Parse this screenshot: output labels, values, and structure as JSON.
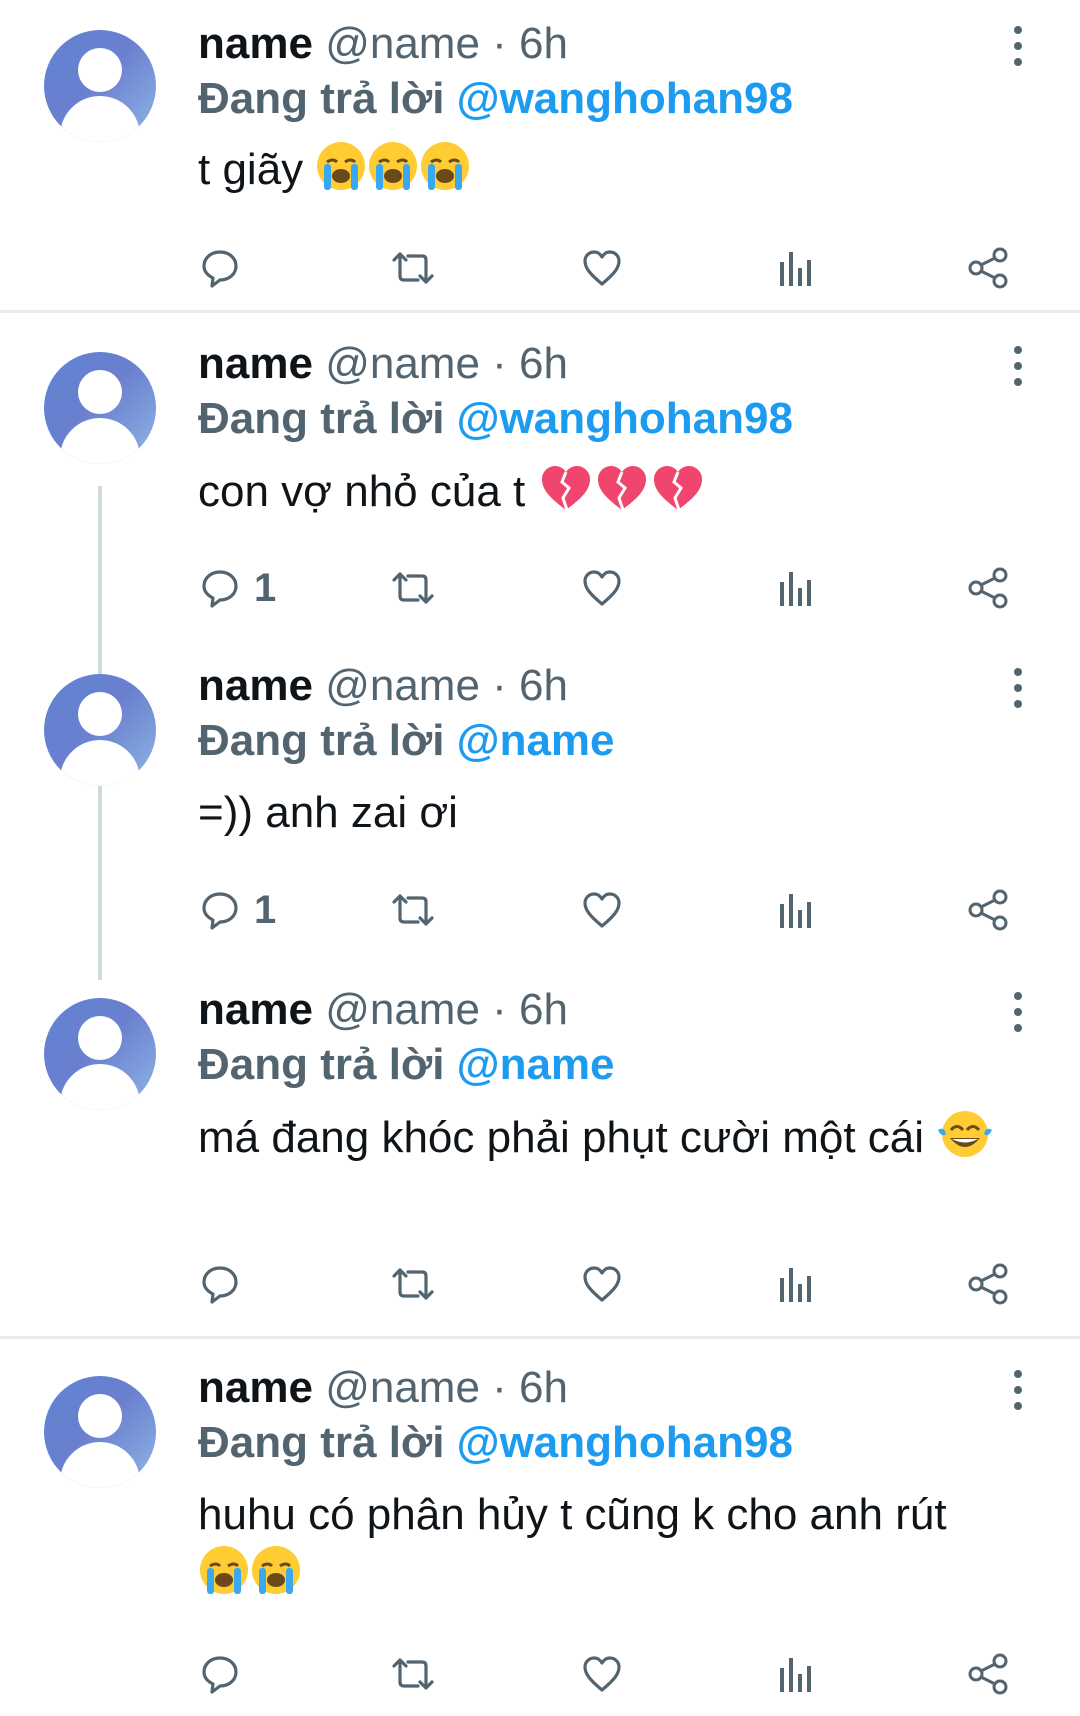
{
  "tweets": [
    {
      "display_name": "name",
      "handle": "@name",
      "separator": "·",
      "time": "6h",
      "reply_prefix": "Đang trả lời",
      "reply_target": "@wanghohan98",
      "text": "t giãy",
      "emojis": [
        "loudly-crying-face",
        "loudly-crying-face",
        "loudly-crying-face"
      ],
      "reply_count": ""
    },
    {
      "display_name": "name",
      "handle": "@name",
      "separator": "·",
      "time": "6h",
      "reply_prefix": "Đang trả lời",
      "reply_target": "@wanghohan98",
      "text": "con vợ nhỏ của t",
      "emojis": [
        "broken-heart",
        "broken-heart",
        "broken-heart"
      ],
      "reply_count": "1"
    },
    {
      "display_name": "name",
      "handle": "@name",
      "separator": "·",
      "time": "6h",
      "reply_prefix": "Đang trả lời",
      "reply_target": "@name",
      "text": "=)) anh zai ơi",
      "emojis": [],
      "reply_count": "1"
    },
    {
      "display_name": "name",
      "handle": "@name",
      "separator": "·",
      "time": "6h",
      "reply_prefix": "Đang trả lời",
      "reply_target": "@name",
      "text": "má đang khóc phải phụt cười một cái",
      "emojis": [
        "face-with-tears-of-joy"
      ],
      "reply_count": ""
    },
    {
      "display_name": "name",
      "handle": "@name",
      "separator": "·",
      "time": "6h",
      "reply_prefix": "Đang trả lời",
      "reply_target": "@wanghohan98",
      "text": "huhu có phân hủy t cũng k cho anh rút",
      "emojis": [
        "loudly-crying-face",
        "loudly-crying-face"
      ],
      "reply_count": ""
    }
  ],
  "icons": {
    "reply": "reply-bubble-icon",
    "retweet": "retweet-icon",
    "like": "heart-icon",
    "views": "analytics-bars-icon",
    "share": "share-icon",
    "more": "more-vertical-icon"
  },
  "colors": {
    "link": "#1d9bf0",
    "secondary_text": "#536471",
    "primary_text": "#0f1419",
    "divider": "#e6ecf0",
    "thread_line": "#cfd9de"
  }
}
